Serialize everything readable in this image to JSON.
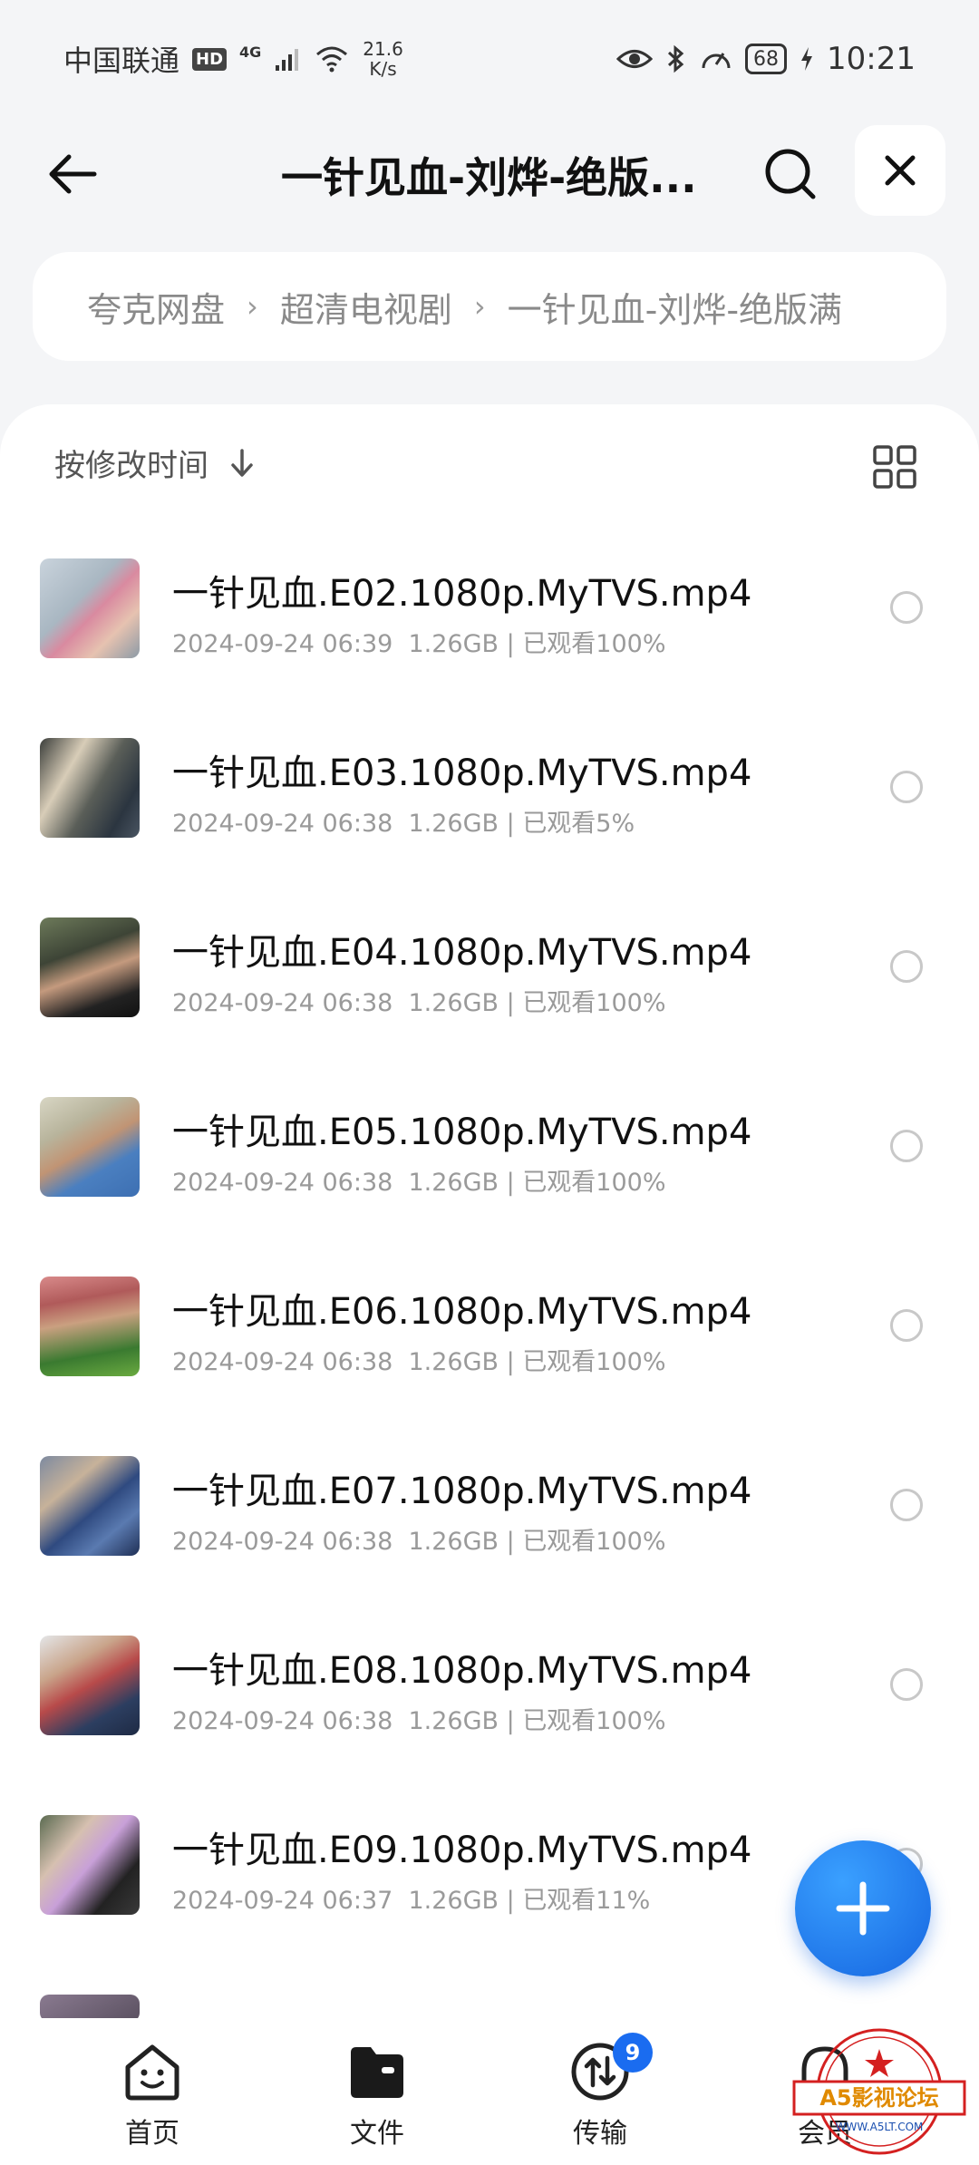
{
  "status_bar": {
    "carrier": "中国联通",
    "hd": "HD",
    "net_type": "4G",
    "speed_value": "21.6",
    "speed_unit": "K/s",
    "battery": "68",
    "time": "10:21"
  },
  "header": {
    "title": "一针见血-刘烨-绝版..."
  },
  "breadcrumb": {
    "items": [
      "夸克网盘",
      "超清电视剧",
      "一针见血-刘烨-绝版满"
    ]
  },
  "sort": {
    "label": "按修改时间"
  },
  "files": [
    {
      "name": "一针见血.E02.1080p.MyTVS.mp4",
      "date": "2024-09-24 06:39",
      "size": "1.26GB",
      "watched": "已观看100%"
    },
    {
      "name": "一针见血.E03.1080p.MyTVS.mp4",
      "date": "2024-09-24 06:38",
      "size": "1.26GB",
      "watched": "已观看5%"
    },
    {
      "name": "一针见血.E04.1080p.MyTVS.mp4",
      "date": "2024-09-24 06:38",
      "size": "1.26GB",
      "watched": "已观看100%"
    },
    {
      "name": "一针见血.E05.1080p.MyTVS.mp4",
      "date": "2024-09-24 06:38",
      "size": "1.26GB",
      "watched": "已观看100%"
    },
    {
      "name": "一针见血.E06.1080p.MyTVS.mp4",
      "date": "2024-09-24 06:38",
      "size": "1.26GB",
      "watched": "已观看100%"
    },
    {
      "name": "一针见血.E07.1080p.MyTVS.mp4",
      "date": "2024-09-24 06:38",
      "size": "1.26GB",
      "watched": "已观看100%"
    },
    {
      "name": "一针见血.E08.1080p.MyTVS.mp4",
      "date": "2024-09-24 06:38",
      "size": "1.26GB",
      "watched": "已观看100%"
    },
    {
      "name": "一针见血.E09.1080p.MyTVS.mp4",
      "date": "2024-09-24 06:37",
      "size": "1.26GB",
      "watched": "已观看11%"
    }
  ],
  "bottom_nav": {
    "home": "首页",
    "files": "文件",
    "transfer": "传输",
    "transfer_badge": "9",
    "member": "会员"
  },
  "watermark": {
    "text": "A5影视论坛",
    "url": "WWW.A5LT.COM"
  },
  "colors": {
    "accent": "#1a6cf0",
    "background": "#f4f5f7"
  }
}
